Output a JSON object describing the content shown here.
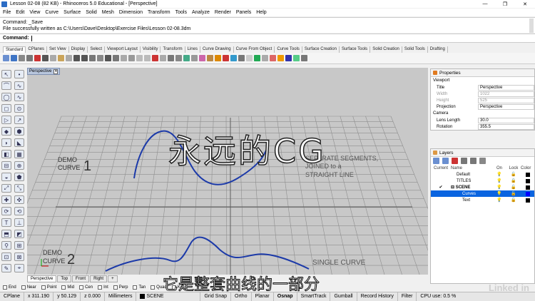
{
  "titlebar": {
    "title": "Lesson 02-08 (82 KB) - Rhinoceros 5.0 Educational - [Perspective]",
    "minimize": "—",
    "restore": "❐",
    "close": "✕"
  },
  "menu": [
    "File",
    "Edit",
    "View",
    "Curve",
    "Surface",
    "Solid",
    "Mesh",
    "Dimension",
    "Transform",
    "Tools",
    "Analyze",
    "Render",
    "Panels",
    "Help"
  ],
  "command_history": {
    "line1": "Command: _Save",
    "line2": "File successfully written as C:\\Users\\Dave\\Desktop\\Exercise Files\\Lesson 02-08.3dm"
  },
  "command_prompt": "Command:",
  "toolbar_tabs": [
    "Standard",
    "CPlanes",
    "Set View",
    "Display",
    "Select",
    "Viewport Layout",
    "Visibility",
    "Transform",
    "Lines",
    "Curve Drawing",
    "Curve From Object",
    "Curve Tools",
    "Surface Creation",
    "Surface Tools",
    "Solid Creation",
    "Solid Tools",
    "Drafting"
  ],
  "toolbar_icon_colors": [
    "#6a8fd0",
    "#3f75c5",
    "#888",
    "#777",
    "#c33",
    "#555",
    "#aaa",
    "#caa45a",
    "#aaa",
    "#555",
    "#555",
    "#777",
    "#888",
    "#555",
    "#777",
    "#aaa",
    "#999",
    "#bbb",
    "#bbb",
    "#c33",
    "#aaa",
    "#777",
    "#888",
    "#4a8",
    "#999",
    "#c6a",
    "#b84",
    "#d80",
    "#c33",
    "#39c",
    "#777",
    "#ccc",
    "#2a5",
    "#aaa",
    "#d66",
    "#e90",
    "#33a",
    "#5c8",
    "#777"
  ],
  "left_tool_glyphs": [
    "↖",
    "•",
    "⌒",
    "∿",
    "◯",
    "∿",
    "◻",
    "⊙",
    "▷",
    "↗",
    "◆",
    "⬢",
    "◗",
    "◣",
    "◧",
    "▦",
    "⊟",
    "⊕",
    "◒",
    "⬟",
    "⤢",
    "⤡",
    "✚",
    "✜",
    "⟳",
    "⟲",
    "T",
    "⊥",
    "⬒",
    "◩",
    "⚲",
    "⊞",
    "⊡",
    "⊠",
    "✎",
    "⌖"
  ],
  "viewport": {
    "label": "Perspective",
    "dropdown": "▾",
    "annotations": {
      "demo1_a": "DEMO",
      "demo1_b": "CURVE",
      "demo1_num": "1",
      "separate_a": "SEPARATE SEGMENTS,",
      "separate_b": "JOINED to a",
      "separate_c": "STRAIGHT LINE",
      "demo2_a": "DEMO",
      "demo2_b": "CURVE",
      "demo2_num": "2",
      "single": "SINGLE CURVE"
    }
  },
  "viewport_tabs": [
    "Perspective",
    "Top",
    "Front",
    "Right",
    "+"
  ],
  "osnap": [
    "End",
    "Near",
    "Point",
    "Mid",
    "Cen",
    "Int",
    "Perp",
    "Tan",
    "Quad",
    "Knot"
  ],
  "status": {
    "plane": "CPlane",
    "x": "x 311.190",
    "y": "y 50.129",
    "z": "z 0.000",
    "units": "Millimeters",
    "layer": "SCENE",
    "grid_snap": "Grid Snap",
    "ortho": "Ortho",
    "planar": "Planar",
    "osnap": "Osnap",
    "smarttrack": "SmartTrack",
    "gumball": "Gumball",
    "record": "Record History",
    "filter": "Filter",
    "cpu": "CPU use: 0.5 %"
  },
  "properties": {
    "title": "Properties",
    "section_viewport": "Viewport",
    "rows": [
      {
        "k": "Title",
        "v": "Perspective"
      },
      {
        "k": "Width",
        "v": "1022"
      },
      {
        "k": "Height",
        "v": "525"
      },
      {
        "k": "Projection",
        "v": "Perspective"
      }
    ],
    "section_camera": "Camera",
    "camera_rows": [
      {
        "k": "Lens Length",
        "v": "30.0"
      },
      {
        "k": "Rotation",
        "v": "355.5"
      }
    ]
  },
  "layers": {
    "title": "Layers",
    "header": {
      "current": "Current",
      "name": "Name",
      "on": "On",
      "lock": "Lock",
      "color": "Color"
    },
    "rows": [
      {
        "cur": "",
        "name": "Default",
        "on": "💡",
        "lock": "🔓",
        "color": "#000000"
      },
      {
        "cur": "",
        "name": "TITLES",
        "on": "💡",
        "lock": "🔒",
        "color": "#000000"
      },
      {
        "cur": "✔",
        "name": "⊟ SCENE",
        "on": "💡",
        "lock": "🔓",
        "color": "#000000"
      },
      {
        "cur": "",
        "name": "Curves",
        "on": "💡",
        "lock": "🔓",
        "color": "#0000ff"
      },
      {
        "cur": "",
        "name": "Text",
        "on": "💡",
        "lock": "🔓",
        "color": "#000000"
      }
    ]
  },
  "overlay": {
    "watermark": "永远的CG",
    "subtitle": "它是整套曲线的一部分",
    "brand": "Linked in"
  }
}
